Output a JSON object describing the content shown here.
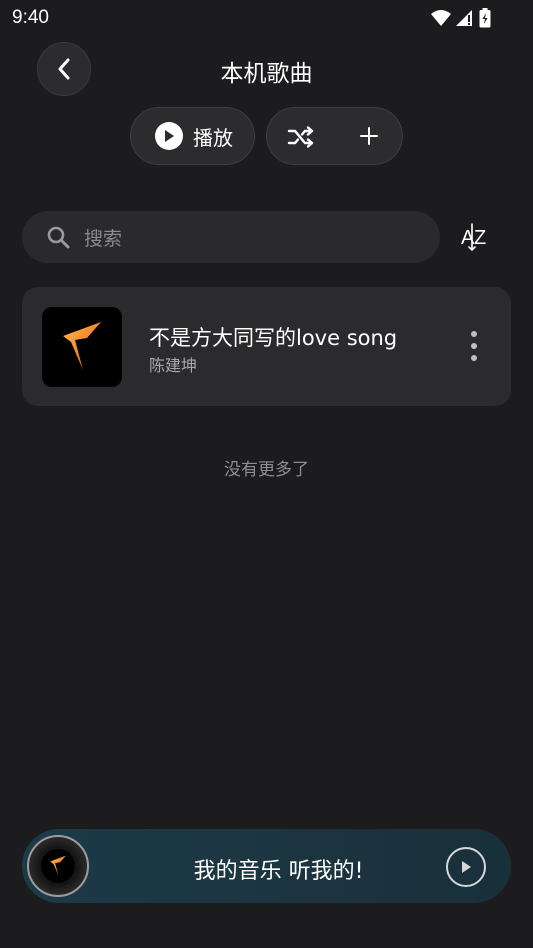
{
  "status_bar": {
    "time": "9:40",
    "icons": [
      "wifi-icon",
      "signal-icon",
      "battery-icon"
    ]
  },
  "header": {
    "title": "本机歌曲",
    "back_icon": "back-chevron-icon"
  },
  "actions": {
    "play_label": "播放",
    "shuffle_icon": "shuffle-icon",
    "add_icon": "plus-icon"
  },
  "search": {
    "placeholder": "搜索",
    "sort_icon": "sort-az-icon"
  },
  "songs": [
    {
      "title": "不是方大同写的love song",
      "artist": "陈建坤"
    }
  ],
  "list_footer": "没有更多了",
  "player": {
    "text": "我的音乐 听我的!",
    "play_icon": "play-icon"
  },
  "colors": {
    "background": "#1c1c1e",
    "card": "#2b2b2d",
    "player_bg": "#1d3a48",
    "accent_orange": "#f5a623"
  }
}
